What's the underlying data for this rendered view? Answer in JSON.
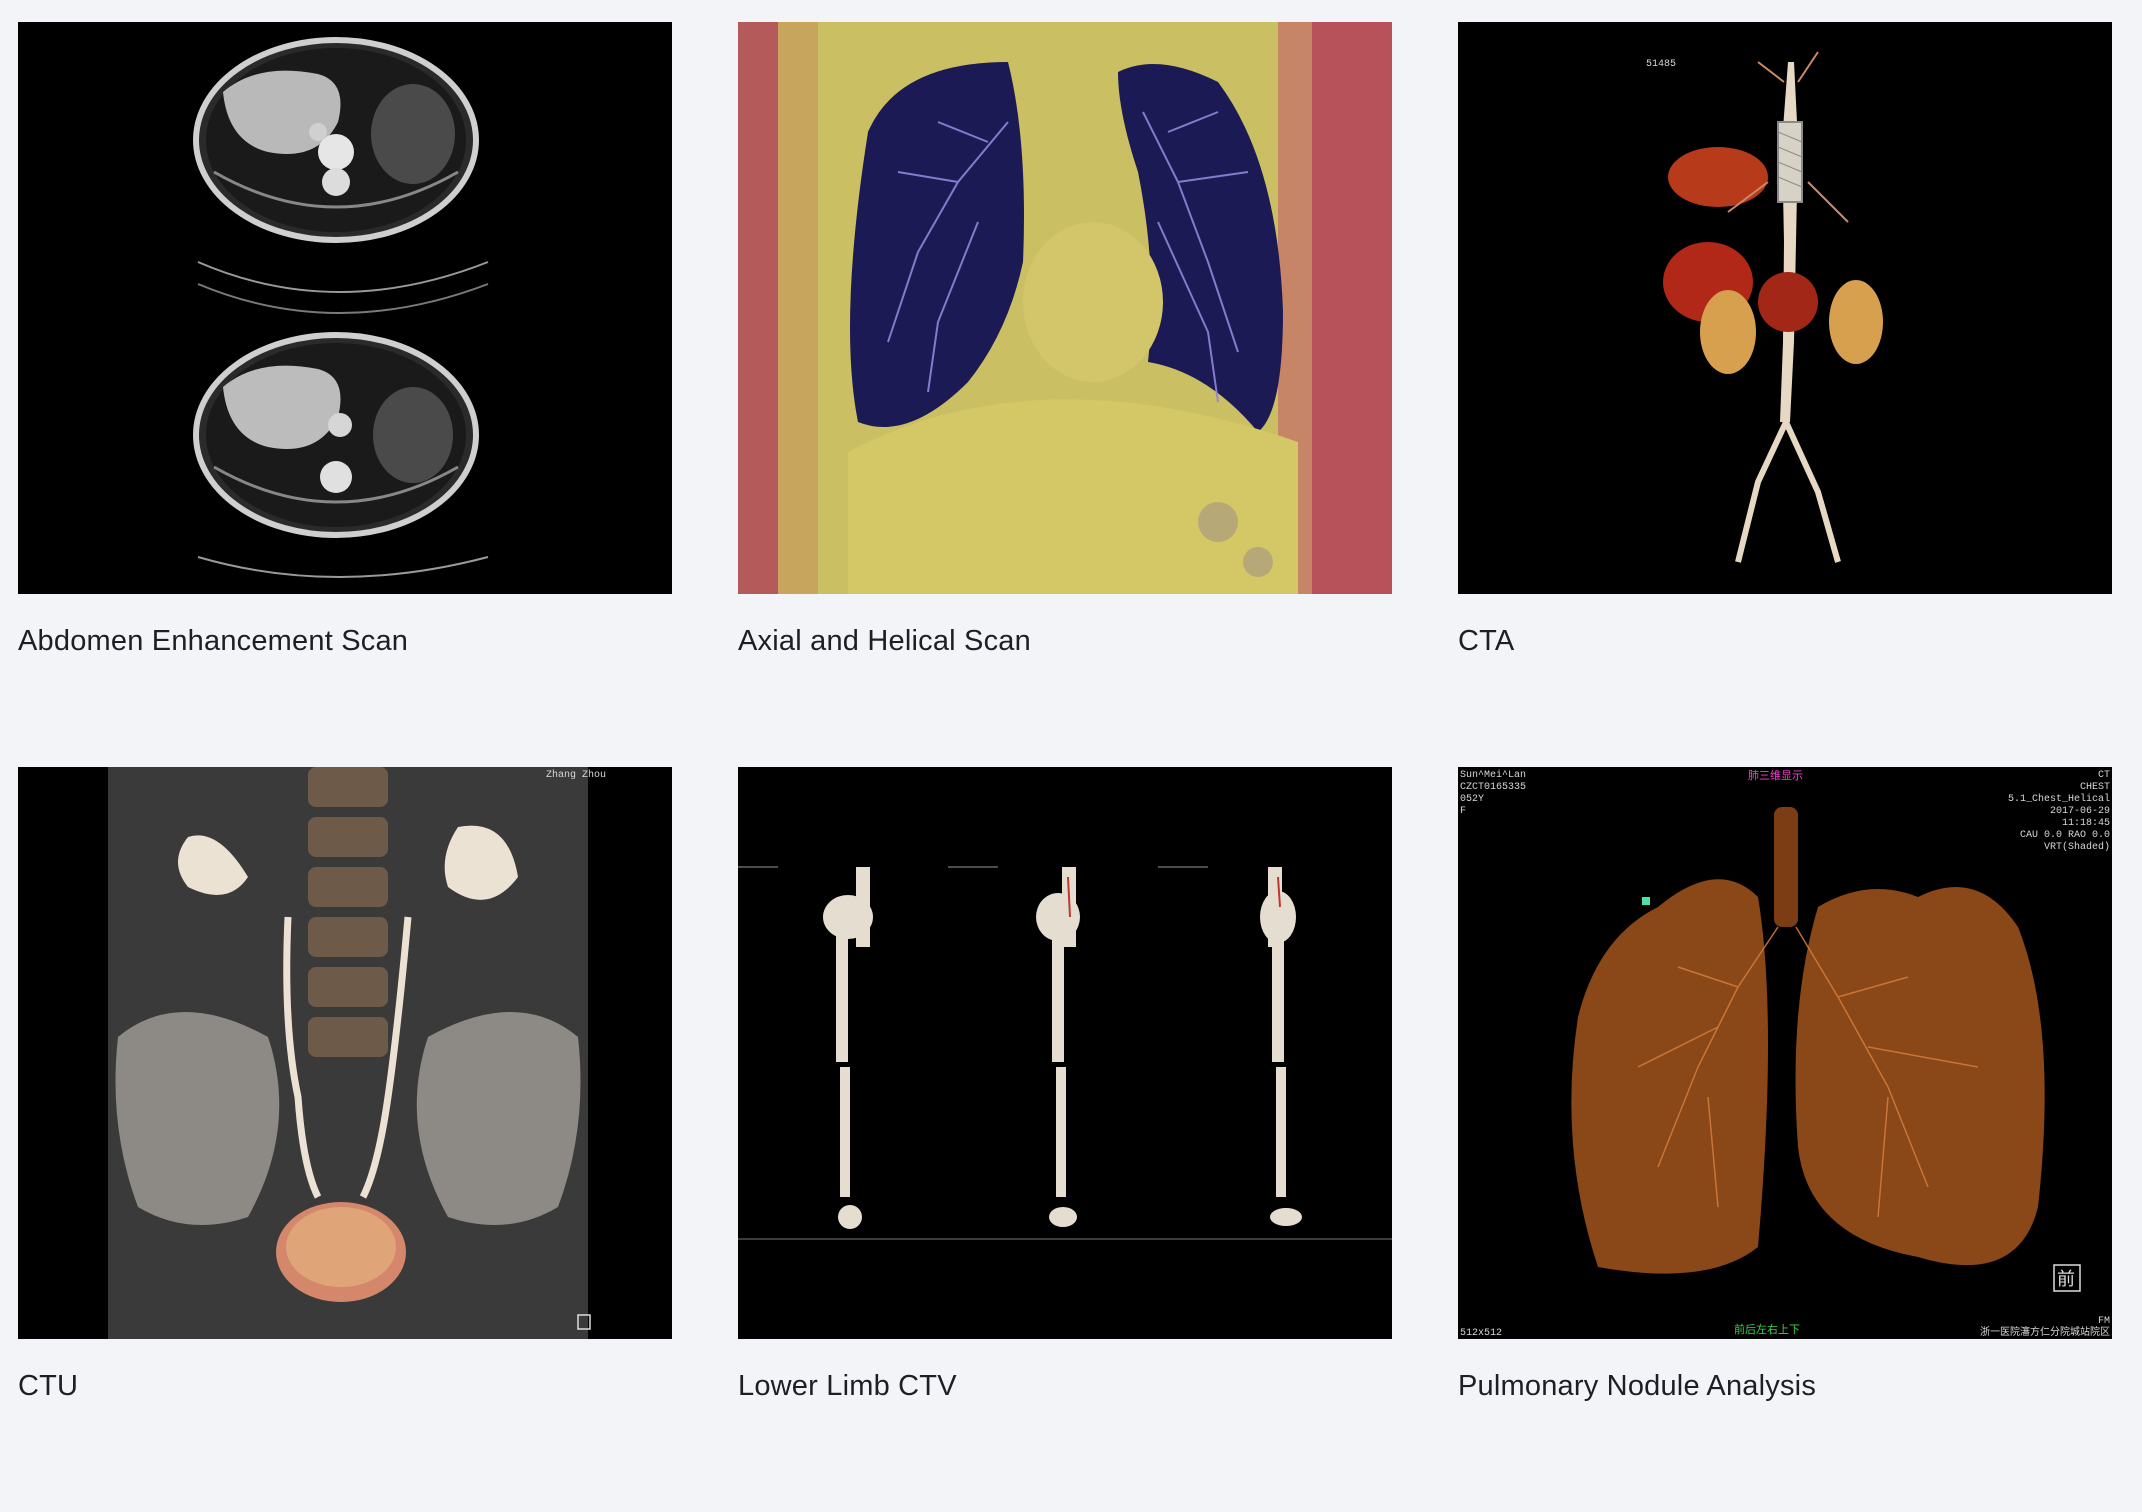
{
  "gallery": {
    "items": [
      {
        "title": "Abdomen Enhancement Scan",
        "image": "ct-abdomen-axial-slices"
      },
      {
        "title": "Axial and Helical Scan",
        "image": "ct-chest-coronal-color"
      },
      {
        "title": "CTA",
        "image": "cta-aorta-3d-render"
      },
      {
        "title": "CTU",
        "image": "ctu-urinary-tract-3d-render"
      },
      {
        "title": "Lower Limb CTV",
        "image": "lower-limb-ctv-3d-views"
      },
      {
        "title": "Pulmonary Nodule Analysis",
        "image": "lung-airway-3d-render"
      }
    ],
    "overlays": {
      "cta_id": "51485",
      "ctu_name": "Zhang Zhou",
      "lung_patient": "Sun^Mei^Lan",
      "lung_id": "CZCT0165335",
      "lung_age": "052Y",
      "lung_sex": "F",
      "lung_header": "肺三维显示",
      "lung_study": "CT",
      "lung_body": "CHEST",
      "lung_series": "5.1_Chest_Helical",
      "lung_date": "2017-06-29",
      "lung_time": "11:18:45",
      "lung_angle": "CAU 0.0    RAO 0.0",
      "lung_mode": "VRT(Shaded)",
      "lung_matrix": "512x512",
      "lung_footer": "前后左右上下",
      "lung_hospital": "浙一医院瀋方仁分院城站院区",
      "lung_view": "前",
      "lung_fm": "FM"
    }
  }
}
